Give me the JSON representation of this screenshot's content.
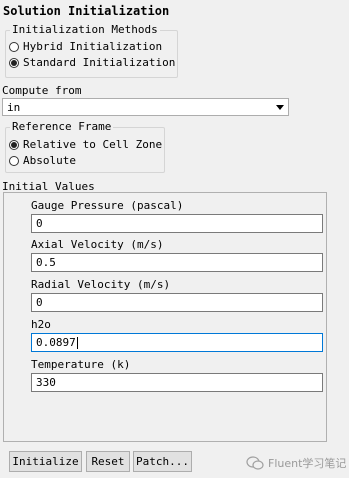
{
  "panel_title": "Solution Initialization",
  "init_methods": {
    "legend": "Initialization Methods",
    "options": [
      {
        "label": "Hybrid  Initialization",
        "selected": false
      },
      {
        "label": "Standard Initialization",
        "selected": true
      }
    ]
  },
  "compute_from": {
    "label": "Compute from",
    "value": "in"
  },
  "reference_frame": {
    "legend": "Reference Frame",
    "options": [
      {
        "label": "Relative to Cell Zone",
        "selected": true
      },
      {
        "label": "Absolute",
        "selected": false
      }
    ]
  },
  "initial_values": {
    "heading": "Initial Values",
    "fields": [
      {
        "label": "Gauge Pressure (pascal)",
        "value": "0"
      },
      {
        "label": "Axial Velocity (m/s)",
        "value": "0.5"
      },
      {
        "label": "Radial Velocity (m/s)",
        "value": "0"
      },
      {
        "label": "h2o",
        "value": "0.0897"
      },
      {
        "label": "Temperature (k)",
        "value": "330"
      }
    ]
  },
  "buttons": {
    "initialize": "Initialize",
    "reset": "Reset",
    "patch": "Patch..."
  },
  "watermark": "Fluent学习笔记"
}
